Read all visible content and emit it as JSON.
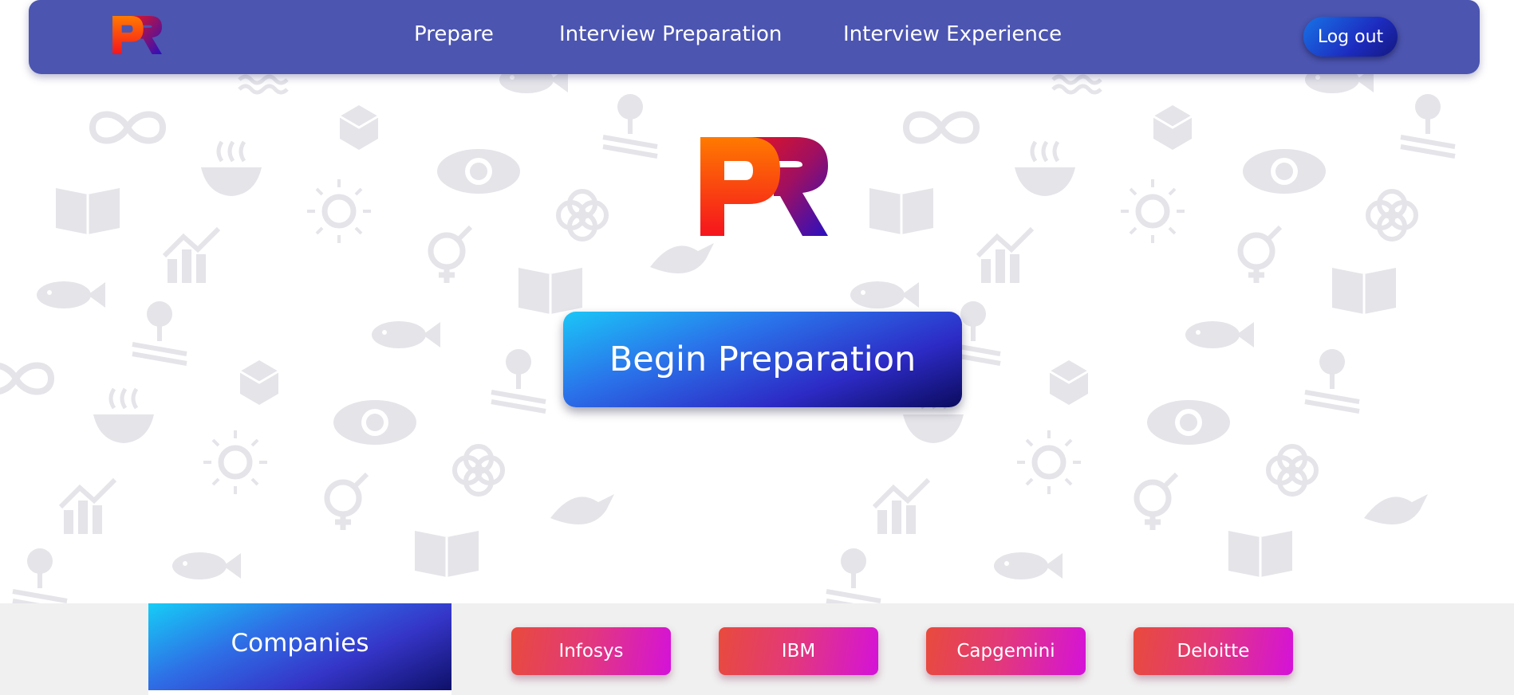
{
  "nav": {
    "logo_text": "PR",
    "links": [
      "Prepare",
      "Interview Preparation",
      "Interview Experience"
    ],
    "logout_label": "Log out"
  },
  "hero": {
    "logo_text": "PR",
    "cta_label": "Begin Preparation"
  },
  "companies": {
    "title": "Companies",
    "items": [
      "Infosys",
      "IBM",
      "Capgemini",
      "Deloitte"
    ]
  },
  "icons": {
    "logo": "pr-logo-icon",
    "background": "sdg-pattern-background"
  },
  "colors": {
    "nav_bg": "#4c55b0",
    "logo_orange": "#ff6a00",
    "logo_red": "#e8141e",
    "logo_purple": "#2a10c0",
    "company_button_start": "#e84b3c",
    "company_button_end": "#d412d9"
  }
}
